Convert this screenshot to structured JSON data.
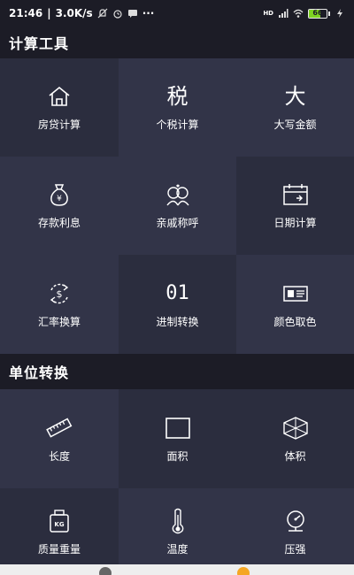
{
  "status_bar": {
    "time": "21:46",
    "speed": "3.0K/s",
    "network_label": "HD",
    "battery_percent": 66,
    "battery_text": "66",
    "battery_color": "#7ed321"
  },
  "sections": [
    {
      "title": "计算工具",
      "items": [
        {
          "label": "房贷计算",
          "icon": "house-icon"
        },
        {
          "label": "个税计算",
          "icon": "tax-glyph-icon",
          "glyph": "税"
        },
        {
          "label": "大写金额",
          "icon": "uppercase-glyph-icon",
          "glyph": "大"
        },
        {
          "label": "存款利息",
          "icon": "money-bag-icon"
        },
        {
          "label": "亲戚称呼",
          "icon": "relatives-icon"
        },
        {
          "label": "日期计算",
          "icon": "calendar-icon"
        },
        {
          "label": "汇率换算",
          "icon": "exchange-icon"
        },
        {
          "label": "进制转换",
          "icon": "binary-icon",
          "glyph": "01"
        },
        {
          "label": "颜色取色",
          "icon": "color-picker-icon"
        }
      ]
    },
    {
      "title": "单位转换",
      "items": [
        {
          "label": "长度",
          "icon": "ruler-icon"
        },
        {
          "label": "面积",
          "icon": "square-icon"
        },
        {
          "label": "体积",
          "icon": "cube-icon"
        },
        {
          "label": "质量重量",
          "icon": "weight-icon",
          "glyph": "KG"
        },
        {
          "label": "温度",
          "icon": "thermometer-icon"
        },
        {
          "label": "压强",
          "icon": "pressure-gauge-icon"
        }
      ]
    }
  ],
  "colors": {
    "background": "#272938",
    "tile": "#323448",
    "tile_dark": "#2b2d3e",
    "header": "#1c1c26",
    "text": "#ffffff"
  }
}
